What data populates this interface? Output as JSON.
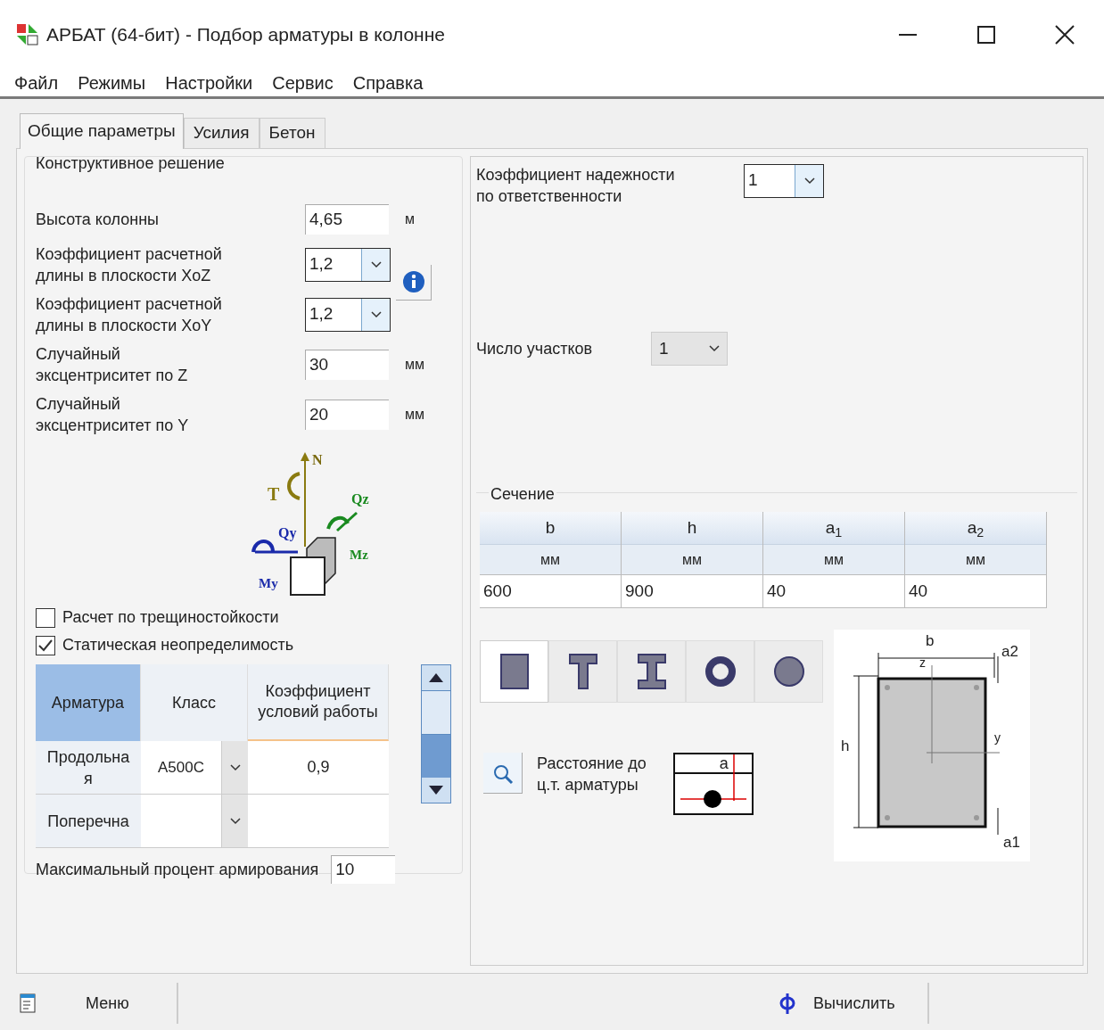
{
  "window": {
    "title": "АРБАТ (64-бит) - Подбор арматуры в колонне"
  },
  "menu": [
    "Файл",
    "Режимы",
    "Настройки",
    "Сервис",
    "Справка"
  ],
  "tabs": [
    {
      "label": "Общие параметры",
      "selected": true
    },
    {
      "label": "Усилия",
      "selected": false
    },
    {
      "label": "Бетон",
      "selected": false
    }
  ],
  "design_group": {
    "title": "Конструктивное решение",
    "fields": [
      {
        "kind": "input",
        "label": "Высота колонны",
        "value": "4,65",
        "unit": "м"
      },
      {
        "kind": "select",
        "label": "Коэффициент расчетной\nдлины в плоскости XoZ",
        "value": "1,2"
      },
      {
        "kind": "select",
        "label": "Коэффициент расчетной\nдлины в плоскости XoY",
        "value": "1,2"
      },
      {
        "kind": "input",
        "label": "Случайный\nэксцентриситет по Z",
        "value": "30",
        "unit": "мм"
      },
      {
        "kind": "input",
        "label": "Случайный\nэксцентриситет по Y",
        "value": "20",
        "unit": "мм"
      }
    ],
    "force_labels": [
      "N",
      "T",
      "Qz",
      "Qy",
      "Mz",
      "My"
    ],
    "checkboxes": [
      {
        "label": "Расчет по трещиностойкости",
        "checked": false
      },
      {
        "label": "Статическая неопределимость",
        "checked": true
      }
    ],
    "rebar_table": {
      "columns": [
        "Арматура",
        "Класс",
        "Коэффициент условий работы"
      ],
      "rows": [
        {
          "name": "Продольна\nя",
          "class": "А500С",
          "factor": "0,9"
        },
        {
          "name": "Поперечна"
        }
      ]
    },
    "max_percent": {
      "label": "Максимальный процент армирования",
      "value": "10"
    }
  },
  "reliability": {
    "label": "Коэффициент надежности\nпо ответственности",
    "value": "1"
  },
  "segments": {
    "label": "Число участков",
    "value": "1"
  },
  "section": {
    "title": "Сечение",
    "columns": [
      {
        "name": "b",
        "unit": "мм",
        "value": "600"
      },
      {
        "name": "h",
        "unit": "мм",
        "value": "900"
      },
      {
        "name": "a$_{1}$",
        "unit": "мм",
        "value": "40"
      },
      {
        "name": "a$_{2}$",
        "unit": "мм",
        "value": "40"
      }
    ],
    "shapes": [
      {
        "kind": "rectangle",
        "selected": true
      },
      {
        "kind": "tee",
        "selected": false
      },
      {
        "kind": "ibeam",
        "selected": false
      },
      {
        "kind": "ring",
        "selected": false
      },
      {
        "kind": "circle",
        "selected": false
      }
    ],
    "distance_label": "Расстояние до\nц.т. арматуры",
    "distance_drawing_label": "a",
    "drawing_labels": [
      "b",
      "z",
      "a2",
      "h",
      "y",
      "a1"
    ]
  },
  "bottom": {
    "menu_button": "Меню",
    "calc_button": "Вычислить"
  }
}
